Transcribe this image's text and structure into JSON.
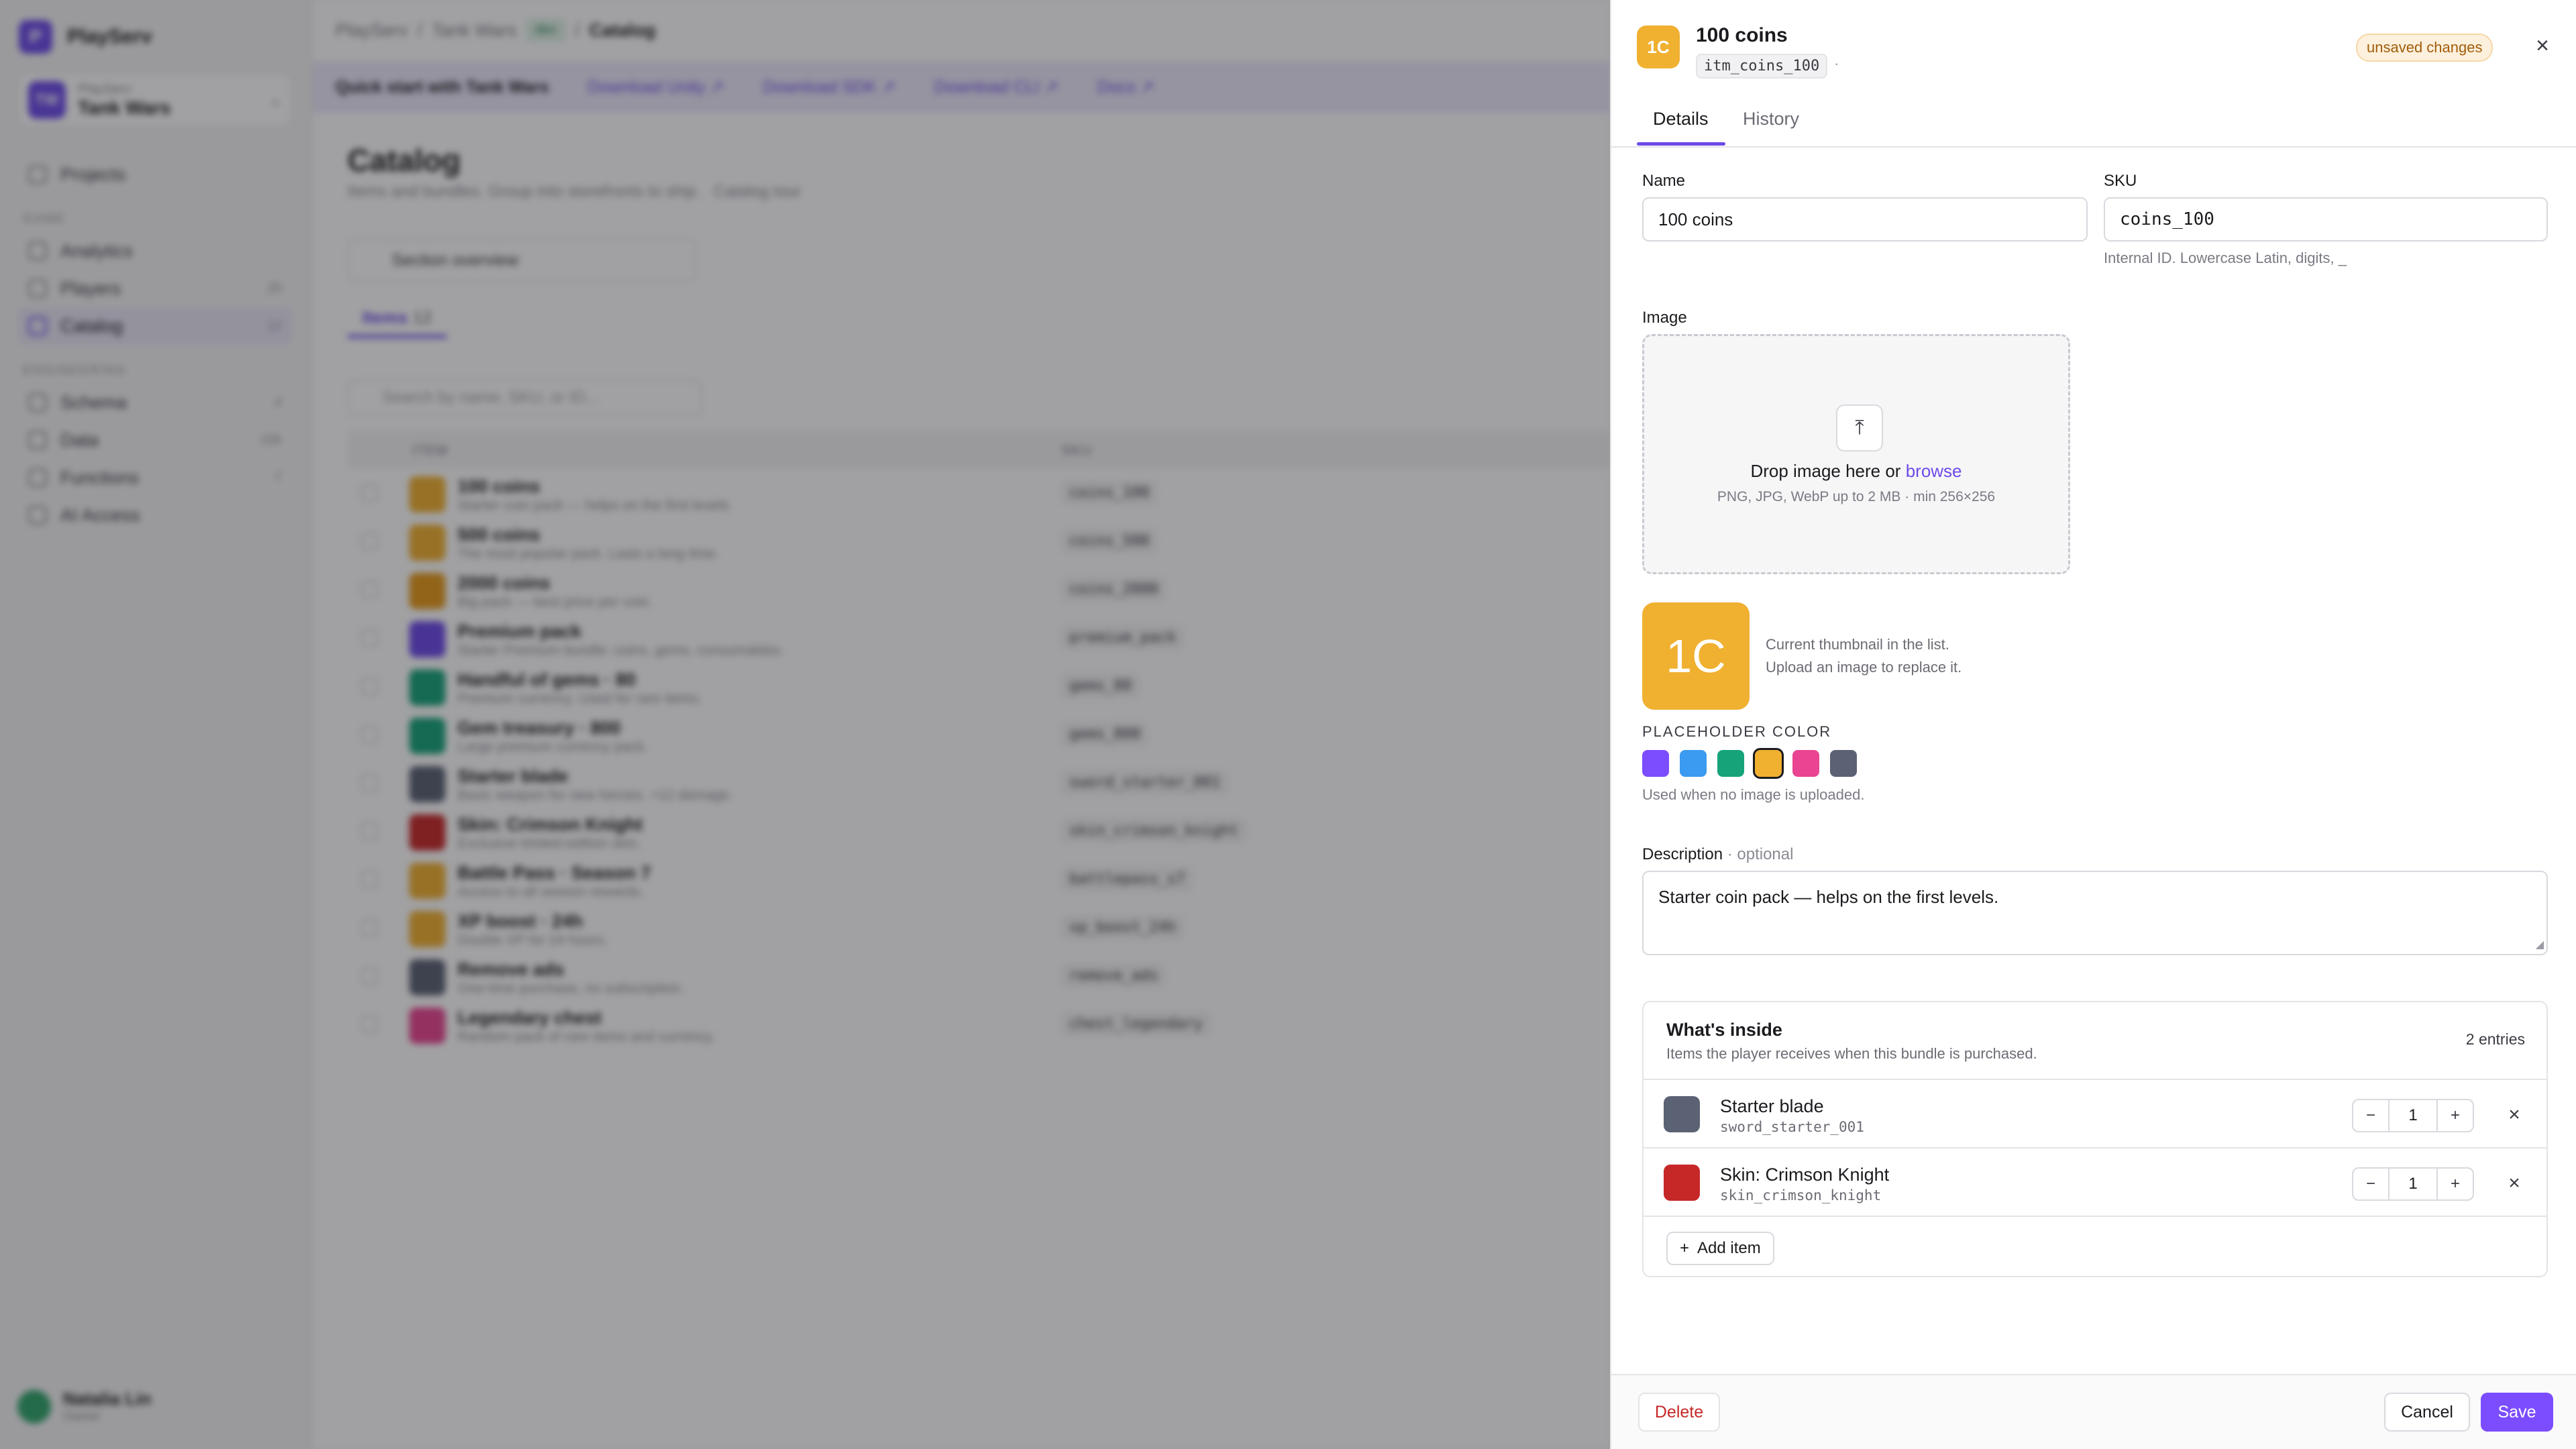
{
  "app": {
    "brand": "PlayServ",
    "brand_initial": "P",
    "project_small": "PlayServ",
    "project_name": "Tank Wars",
    "project_initials": "TW",
    "nav": [
      {
        "label": "Projects",
        "count": ""
      },
      {
        "section": "GAME"
      },
      {
        "label": "Analytics",
        "count": ""
      },
      {
        "label": "Players",
        "count": "20"
      },
      {
        "label": "Catalog",
        "count": "12"
      },
      {
        "section": "ENGINEERING"
      },
      {
        "label": "Schema",
        "count": "4"
      },
      {
        "label": "Data",
        "count": "10k"
      },
      {
        "label": "Functions",
        "count": "7"
      },
      {
        "label": "AI Access",
        "count": ""
      }
    ],
    "user_name": "Natalia Lin",
    "user_role": "Owner",
    "crumbs": [
      "PlayServ",
      "Tank Wars",
      "dev",
      "Catalog"
    ],
    "quickstart": {
      "title": "Quick start with Tank Wars",
      "links": [
        "Download Unity ↗",
        "Download SDK ↗",
        "Download CLI ↗",
        "Docs ↗"
      ]
    },
    "page_title": "Catalog",
    "page_sub": "Items and bundles. Group into storefronts to ship.",
    "catalog_tour": "Catalog tour",
    "section_overview": "Section overview",
    "tab_items": "Items",
    "tab_items_count": "12",
    "search_placeholder": "Search by name, SKU, or ID...",
    "col_item": "ITEM",
    "col_sku": "SKU",
    "rows": [
      {
        "name": "100 coins",
        "desc": "Starter coin pack — helps on the first levels.",
        "sku": "coins_100",
        "color": "#f0b030"
      },
      {
        "name": "500 coins",
        "desc": "The most popular pack. Lasts a long time.",
        "sku": "coins_500",
        "color": "#f0b030"
      },
      {
        "name": "2000 coins",
        "desc": "Big pack — best price per coin.",
        "sku": "coins_2000",
        "color": "#e59a1a"
      },
      {
        "name": "Premium pack",
        "desc": "Starter Premium bundle: coins, gems, consumables.",
        "sku": "premium_pack",
        "color": "#6d4ae8"
      },
      {
        "name": "Handful of gems · 80",
        "desc": "Premium currency. Used for rare items.",
        "sku": "gems_80",
        "color": "#16a37a"
      },
      {
        "name": "Gem treasury · 800",
        "desc": "Large premium currency pack.",
        "sku": "gems_800",
        "color": "#16a37a"
      },
      {
        "name": "Starter blade",
        "desc": "Basic weapon for new heroes. +12 damage.",
        "sku": "sword_starter_001",
        "color": "#5b6274"
      },
      {
        "name": "Skin: Crimson Knight",
        "desc": "Exclusive limited-edition skin.",
        "sku": "skin_crimson_knight",
        "color": "#c62828"
      },
      {
        "name": "Battle Pass · Season 7",
        "desc": "Access to all season rewards.",
        "sku": "battlepass_s7",
        "color": "#f0b030"
      },
      {
        "name": "XP boost · 24h",
        "desc": "Double XP for 24 hours.",
        "sku": "xp_boost_24h",
        "color": "#f0b030"
      },
      {
        "name": "Remove ads",
        "desc": "One-time purchase, no subscription.",
        "sku": "remove_ads",
        "color": "#5b6274"
      },
      {
        "name": "Legendary chest",
        "desc": "Random pack of rare items and currency.",
        "sku": "chest_legendary",
        "color": "#e94592"
      }
    ]
  },
  "drawer": {
    "thumb_initials": "1C",
    "title": "100 coins",
    "item_id": "itm_coins_100",
    "id_suffix": "·",
    "badge": "unsaved changes",
    "close_icon": "×",
    "tabs": [
      "Details",
      "History"
    ],
    "name_label": "Name",
    "name_value": "100 coins",
    "sku_label": "SKU",
    "sku_value": "coins_100",
    "sku_help": "Internal ID. Lowercase Latin, digits, _",
    "image_label": "Image",
    "drop_icon": "⤒",
    "drop_text": "Drop image here or ",
    "drop_browse": "browse",
    "drop_sub": "PNG, JPG, WebP up to 2 MB · min 256×256",
    "thumb_note_1": "Current thumbnail in the list.",
    "thumb_note_2": "Upload an image to replace it.",
    "placeholder_label": "PLACEHOLDER COLOR",
    "swatches": [
      "#7c4dff",
      "#3b9bf0",
      "#16a37a",
      "#f0b030",
      "#e94592",
      "#5b6274"
    ],
    "selected_swatch": 3,
    "placeholder_help": "Used when no image is uploaded.",
    "description_label": "Description",
    "description_optional": " · optional",
    "description_value": "Starter coin pack — helps on the first levels.",
    "inside_title": "What's inside",
    "inside_sub": "Items the player receives when this bundle is purchased.",
    "inside_count": "2 entries",
    "entries": [
      {
        "name": "Starter blade",
        "sku": "sword_starter_001",
        "qty": "1",
        "color": "#5b6274"
      },
      {
        "name": "Skin: Crimson Knight",
        "sku": "skin_crimson_knight",
        "qty": "1",
        "color": "#c62828"
      }
    ],
    "minus": "−",
    "plus": "+",
    "remove_icon": "×",
    "add_item_icon": "+",
    "add_item": "Add item",
    "delete": "Delete",
    "cancel": "Cancel",
    "save": "Save"
  },
  "colors": {
    "accent": "#7c4dff",
    "thumb": "#f0b030"
  }
}
